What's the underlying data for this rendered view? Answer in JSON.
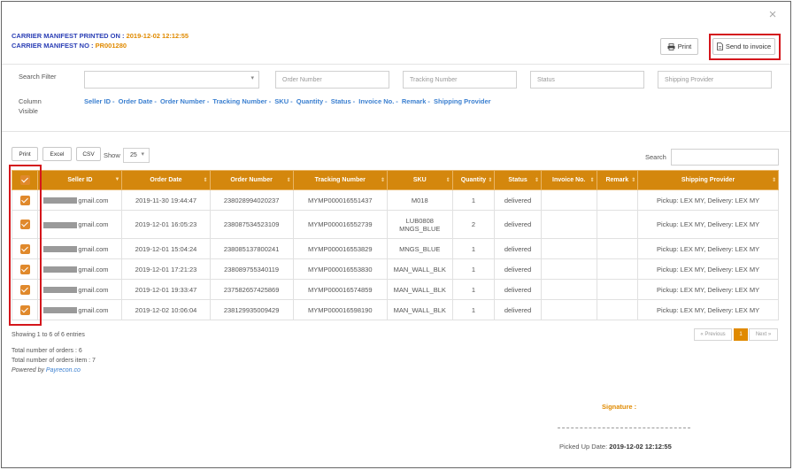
{
  "header": {
    "printed_label": "CARRIER MANIFEST PRINTED ON :",
    "printed_value": "2019-12-02 12:12:55",
    "no_label": "CARRIER MANIFEST NO :",
    "no_value": "PR001280"
  },
  "close_glyph": "×",
  "toolbar": {
    "print_label": "Print",
    "send_label": "Send to invoice"
  },
  "filter": {
    "search_filter_label": "Search Filter",
    "order_number_placeholder": "Order Number",
    "tracking_number_placeholder": "Tracking Number",
    "status_placeholder": "Status",
    "shipping_provider_placeholder": "Shipping Provider",
    "column_visible_label_1": "Column",
    "column_visible_label_2": "Visible",
    "columns": [
      "Seller ID",
      "Order Date",
      "Order Number",
      "Tracking Number",
      "SKU",
      "Quantity",
      "Status",
      "Invoice No.",
      "Remark",
      "Shipping Provider"
    ]
  },
  "table_controls": {
    "print": "Print",
    "excel": "Excel",
    "csv": "CSV",
    "show_label": "Show",
    "show_value": "25",
    "search_label": "Search"
  },
  "table": {
    "headers": [
      "Seller ID",
      "Order Date",
      "Order Number",
      "Tracking Number",
      "SKU",
      "Quantity",
      "Status",
      "Invoice No.",
      "Remark",
      "Shipping Provider"
    ],
    "rows": [
      {
        "seller": "gmail.com",
        "date": "2019-11-30 19:44:47",
        "order": "238028994020237",
        "tracking": "MYMP000016551437",
        "sku1": "M018",
        "sku2": "",
        "qty": "1",
        "status": "delivered",
        "invoice": "",
        "remark": "",
        "provider": "Pickup: LEX MY, Delivery: LEX MY"
      },
      {
        "seller": "gmail.com",
        "date": "2019-12-01 16:05:23",
        "order": "238087534523109",
        "tracking": "MYMP000016552739",
        "sku1": "LUB0808",
        "sku2": "MNGS_BLUE",
        "qty": "2",
        "status": "delivered",
        "invoice": "",
        "remark": "",
        "provider": "Pickup: LEX MY, Delivery: LEX MY"
      },
      {
        "seller": "gmail.com",
        "date": "2019-12-01 15:04:24",
        "order": "238085137800241",
        "tracking": "MYMP000016553829",
        "sku1": "MNGS_BLUE",
        "sku2": "",
        "qty": "1",
        "status": "delivered",
        "invoice": "",
        "remark": "",
        "provider": "Pickup: LEX MY, Delivery: LEX MY"
      },
      {
        "seller": "gmail.com",
        "date": "2019-12-01 17:21:23",
        "order": "238089755340119",
        "tracking": "MYMP000016553830",
        "sku1": "MAN_WALL_BLK",
        "sku2": "",
        "qty": "1",
        "status": "delivered",
        "invoice": "",
        "remark": "",
        "provider": "Pickup: LEX MY, Delivery: LEX MY"
      },
      {
        "seller": "gmail.com",
        "date": "2019-12-01 19:33:47",
        "order": "237582657425869",
        "tracking": "MYMP000016574859",
        "sku1": "MAN_WALL_BLK",
        "sku2": "",
        "qty": "1",
        "status": "delivered",
        "invoice": "",
        "remark": "",
        "provider": "Pickup: LEX MY, Delivery: LEX MY"
      },
      {
        "seller": "gmail.com",
        "date": "2019-12-02 10:06:04",
        "order": "238129935009429",
        "tracking": "MYMP000016598190",
        "sku1": "MAN_WALL_BLK",
        "sku2": "",
        "qty": "1",
        "status": "delivered",
        "invoice": "",
        "remark": "",
        "provider": "Pickup: LEX MY, Delivery: LEX MY"
      }
    ]
  },
  "footer": {
    "showing": "Showing 1 to 6 of 6 entries",
    "total_orders": "Total number of orders : 6",
    "total_items": "Total number of orders item : 7",
    "powered_by": "Powered by",
    "powered_link": "Payrecon.co",
    "prev": "« Previous",
    "page": "1",
    "next": "Next »"
  },
  "signature": {
    "label": "Signature :",
    "picked_label": "Picked Up Date:",
    "picked_value": "2019-12-02 12:12:55"
  },
  "colors": {
    "header_orange": "#d4870d",
    "accent_blue": "#2b3fb5",
    "highlight_red": "#d4161c"
  }
}
